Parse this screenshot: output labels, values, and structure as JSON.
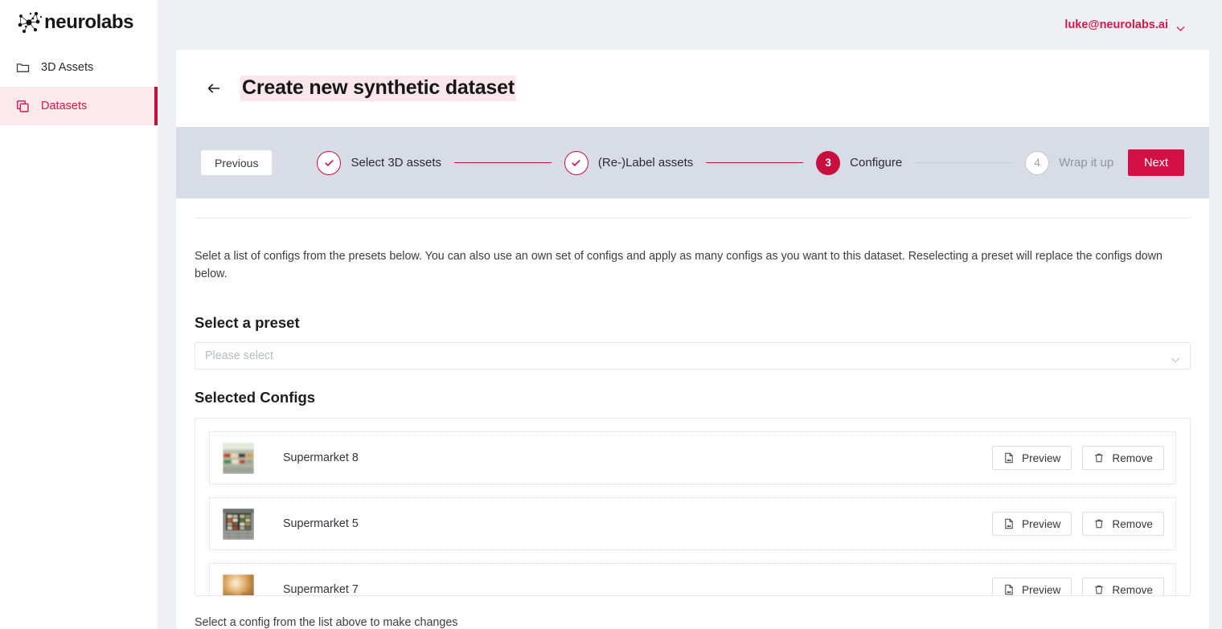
{
  "brand": {
    "name": "neurolabs",
    "logo_icon": "neurolabs-constellation-logo",
    "accent": "#c8103f",
    "accent_soft": "#fde8ec"
  },
  "sidebar": {
    "items": [
      {
        "label": "3D Assets",
        "icon": "folder-icon",
        "active": false
      },
      {
        "label": "Datasets",
        "icon": "layers-copy-icon",
        "active": true
      }
    ]
  },
  "topbar": {
    "user_email": "luke@neurolabs.ai",
    "chevron_icon": "chevron-down-icon"
  },
  "header": {
    "back_icon": "arrow-left-icon",
    "title": "Create new synthetic dataset"
  },
  "stepper": {
    "previous_label": "Previous",
    "next_label": "Next",
    "steps": [
      {
        "number": "1",
        "label": "Select 3D assets",
        "state": "done",
        "icon": "check-icon"
      },
      {
        "number": "2",
        "label": "(Re-)Label assets",
        "state": "done",
        "icon": "check-icon"
      },
      {
        "number": "3",
        "label": "Configure",
        "state": "current"
      },
      {
        "number": "4",
        "label": "Wrap it up",
        "state": "todo"
      }
    ]
  },
  "main": {
    "intro": "Selet a list of configs from the presets below. You can also use an own set of configs and apply as many configs as you want to this dataset. Reselecting a preset will replace the configs down below.",
    "preset": {
      "heading": "Select a preset",
      "placeholder": "Please select",
      "value": "",
      "chevron_icon": "chevron-down-icon"
    },
    "configs": {
      "heading": "Selected Configs",
      "preview_label": "Preview",
      "remove_label": "Remove",
      "preview_icon": "file-image-icon",
      "remove_icon": "trash-icon",
      "rows": [
        {
          "name": "Supermarket 8",
          "thumb": "supermarket-shelf-light-green"
        },
        {
          "name": "Supermarket 5",
          "thumb": "supermarket-shelf-dark-tile"
        },
        {
          "name": "Supermarket 7",
          "thumb": "supermarket-shelf-warm-orange"
        }
      ]
    },
    "hint": "Select a config from the list above to make changes"
  }
}
